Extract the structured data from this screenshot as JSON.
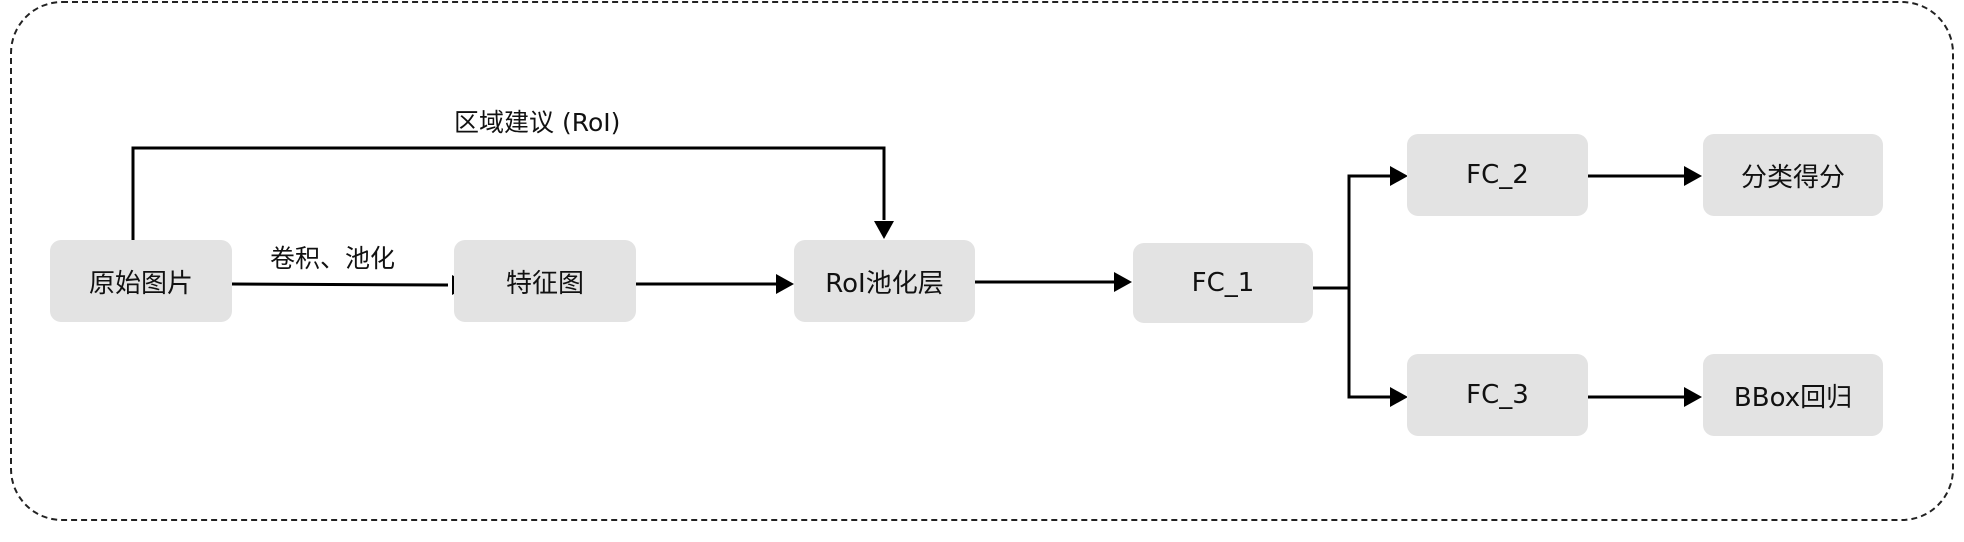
{
  "nodes": {
    "original_image": "原始图片",
    "feature_map": "特征图",
    "roi_pooling": "RoI池化层",
    "fc_1": "FC_1",
    "fc_2": "FC_2",
    "fc_3": "FC_3",
    "class_score": "分类得分",
    "bbox_regression": "BBox回归"
  },
  "edges": {
    "conv_pool_label": "卷积、池化",
    "region_proposal_label": "区域建议 (RoI)"
  }
}
